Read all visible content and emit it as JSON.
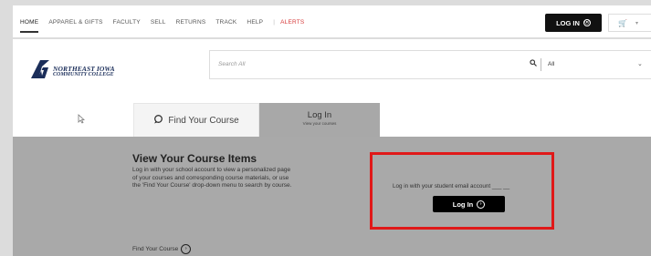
{
  "nav": {
    "items": [
      "HOME",
      "APPAREL & GIFTS",
      "FACULTY",
      "SELL",
      "RETURNS",
      "TRACK",
      "HELP"
    ],
    "separator": "|",
    "alerts": "ALERTS"
  },
  "account": {
    "login_label": "LOG IN",
    "login_icon": "⦿"
  },
  "cart": {
    "icon": "cart-icon",
    "glyph": "🛒",
    "caret": "▾"
  },
  "logo": {
    "line1": "NORTHEAST IOWA",
    "line2": "COMMUNITY COLLEGE",
    "color": "#1b2e5a"
  },
  "search": {
    "placeholder": "Search All",
    "scope": "All",
    "caret": "⌄"
  },
  "tabs": {
    "find": {
      "label": "Find Your Course"
    },
    "login": {
      "label": "Log In",
      "sublabel": "View your courses"
    }
  },
  "course_items": {
    "title": "View Your Course Items",
    "body": "Log in with your school account to view a personalized page of your courses and corresponding course materials, or use the 'Find Your Course' drop-down menu to search by course.",
    "link_label": "Find Your Course"
  },
  "login_box": {
    "message": "Log in with your student email account ___ __",
    "button_label": "Log In",
    "highlight_color": "#e01919"
  }
}
